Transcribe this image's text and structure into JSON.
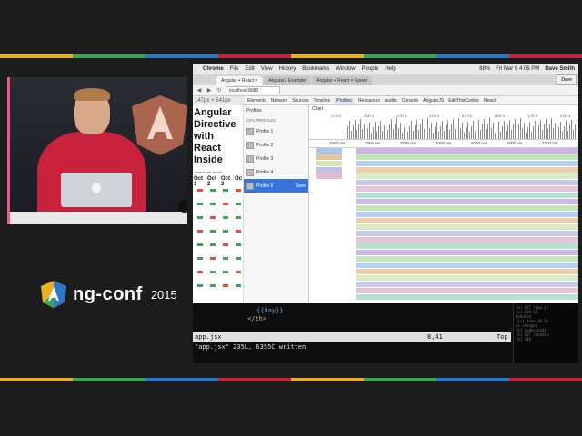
{
  "brand_colors": [
    "#e8b023",
    "#3aa655",
    "#2d77c8",
    "#c8223c",
    "#e8b023",
    "#3aa655",
    "#2d77c8",
    "#c8223c"
  ],
  "conference": {
    "name": "ng-conf",
    "year": "2015"
  },
  "video": {
    "shirt_logo": "Angular"
  },
  "mac_menubar": {
    "apple_icon": "apple-icon",
    "items": [
      "Chrome",
      "File",
      "Edit",
      "View",
      "History",
      "Bookmarks",
      "Window",
      "People",
      "Help"
    ],
    "battery": "88%",
    "clock": "Fri Mar 6  4:06 PM",
    "user": "Dave Smith"
  },
  "browser": {
    "tabs": [
      {
        "label": "Angular + React =",
        "active": true
      },
      {
        "label": "Angular2 Example",
        "active": false
      },
      {
        "label": "Angular + React = Speed",
        "active": false
      }
    ],
    "profile_button": "Dave",
    "url": "localhost:8080"
  },
  "page": {
    "dims": "147px × 541px",
    "title": "Angular Directive with React Inside",
    "search_label": "Search all month",
    "calendar_headers": [
      "Oct 1",
      "Oct 2",
      "Oct 3",
      "Oc"
    ]
  },
  "devtools": {
    "tabs": [
      "Elements",
      "Network",
      "Sources",
      "Timeline",
      "Profiles",
      "Resources",
      "Audits",
      "Console",
      "AngularJS",
      "EditThisCookie",
      "React"
    ],
    "selected_tab": "Profiles",
    "sidebar_title": "Profiles",
    "section_label": "CPU PROFILES",
    "profiles": [
      {
        "label": "Profile 1",
        "selected": false
      },
      {
        "label": "Profile 2",
        "selected": false
      },
      {
        "label": "Profile 3",
        "selected": false
      },
      {
        "label": "Profile 4",
        "selected": false
      },
      {
        "label": "Profile 5",
        "selected": true,
        "action": "Save"
      }
    ],
    "chart_label": "Chart",
    "overview_ticks": [
      "2.00 s",
      "2.00 s",
      "2.00 s",
      "4.00 s",
      "6.00 s",
      "8.00 s",
      "1.00 s",
      "2.00 s"
    ],
    "ruler_ticks": [
      "1000 ms",
      "2000 ms",
      "3000 ms",
      "4000 ms",
      "5000 ms",
      "6000 ms",
      "7000 ms"
    ]
  },
  "terminal": {
    "line1": "{{day}}",
    "line2": "</th>",
    "file": "app.jsx",
    "position": "8,41",
    "scroll": "Top",
    "message": "\"app.jsx\" 235L, 6355C written",
    "side_lines": [
      "[b] GET /app.js",
      "[b] 200 ok",
      "Rebuild",
      "[js] done 10.1s",
      "no changes",
      "[b] index.html",
      "[b] GET /bundle",
      "[b] 304"
    ]
  }
}
